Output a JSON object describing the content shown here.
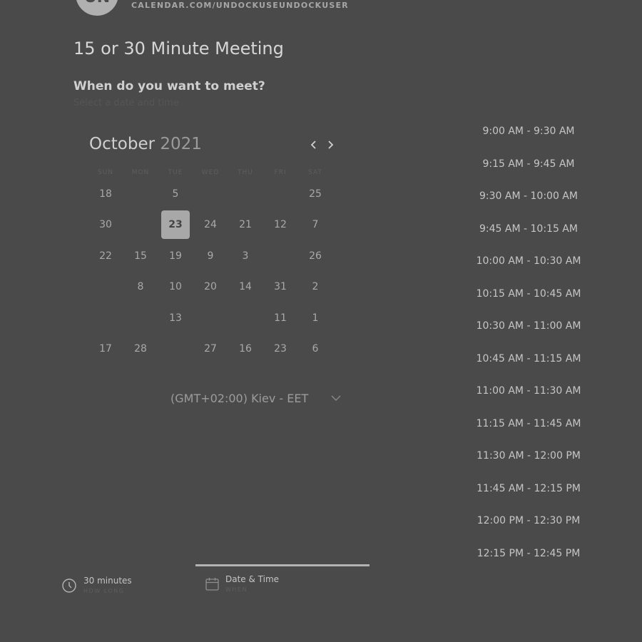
{
  "header": {
    "avatar_initials": "UN",
    "url": "CALENDAR.COM/UNDOCKUSEUNDOCKUSER"
  },
  "meeting": {
    "title": "15 or 30 Minute Meeting",
    "question": "When do you want to meet?",
    "subtext": "Select a date and time"
  },
  "calendar": {
    "month": "October",
    "year": "2021",
    "weekdays": [
      "SUN",
      "MON",
      "TUE",
      "WED",
      "THU",
      "FRI",
      "SAT"
    ],
    "rows": [
      [
        "18",
        "",
        "5",
        "",
        "",
        "",
        "25"
      ],
      [
        "30",
        "",
        "23",
        "24",
        "21",
        "12",
        "7"
      ],
      [
        "22",
        "15",
        "19",
        "9",
        "3",
        "",
        "26"
      ],
      [
        "",
        "8",
        "10",
        "20",
        "14",
        "31",
        "2"
      ],
      [
        "",
        "",
        "13",
        "",
        "",
        "11",
        "1"
      ],
      [
        "17",
        "28",
        "",
        "27",
        "16",
        "23",
        "6"
      ]
    ],
    "selected": "23"
  },
  "timezone": "(GMT+02:00) Kiev - EET",
  "slots": [
    "9:00 AM - 9:30 AM",
    "9:15 AM - 9:45 AM",
    "9:30 AM - 10:00 AM",
    "9:45 AM - 10:15 AM",
    "10:00 AM - 10:30 AM",
    "10:15 AM - 10:45 AM",
    "10:30 AM - 11:00 AM",
    "10:45 AM - 11:15 AM",
    "11:00 AM - 11:30 AM",
    "11:15 AM - 11:45 AM",
    "11:30 AM - 12:00 PM",
    "11:45 AM - 12:15 PM",
    "12:00 PM - 12:30 PM",
    "12:15 PM - 12:45 PM"
  ],
  "steps": [
    {
      "label": "30 minutes",
      "sub": "HOW LONG",
      "icon": "clock-icon"
    },
    {
      "label": "Date & Time",
      "sub": "WHEN",
      "icon": "calendar-icon"
    }
  ],
  "colors": {
    "background": "#4a4a4a",
    "selected_day": "#a8a8a8"
  }
}
